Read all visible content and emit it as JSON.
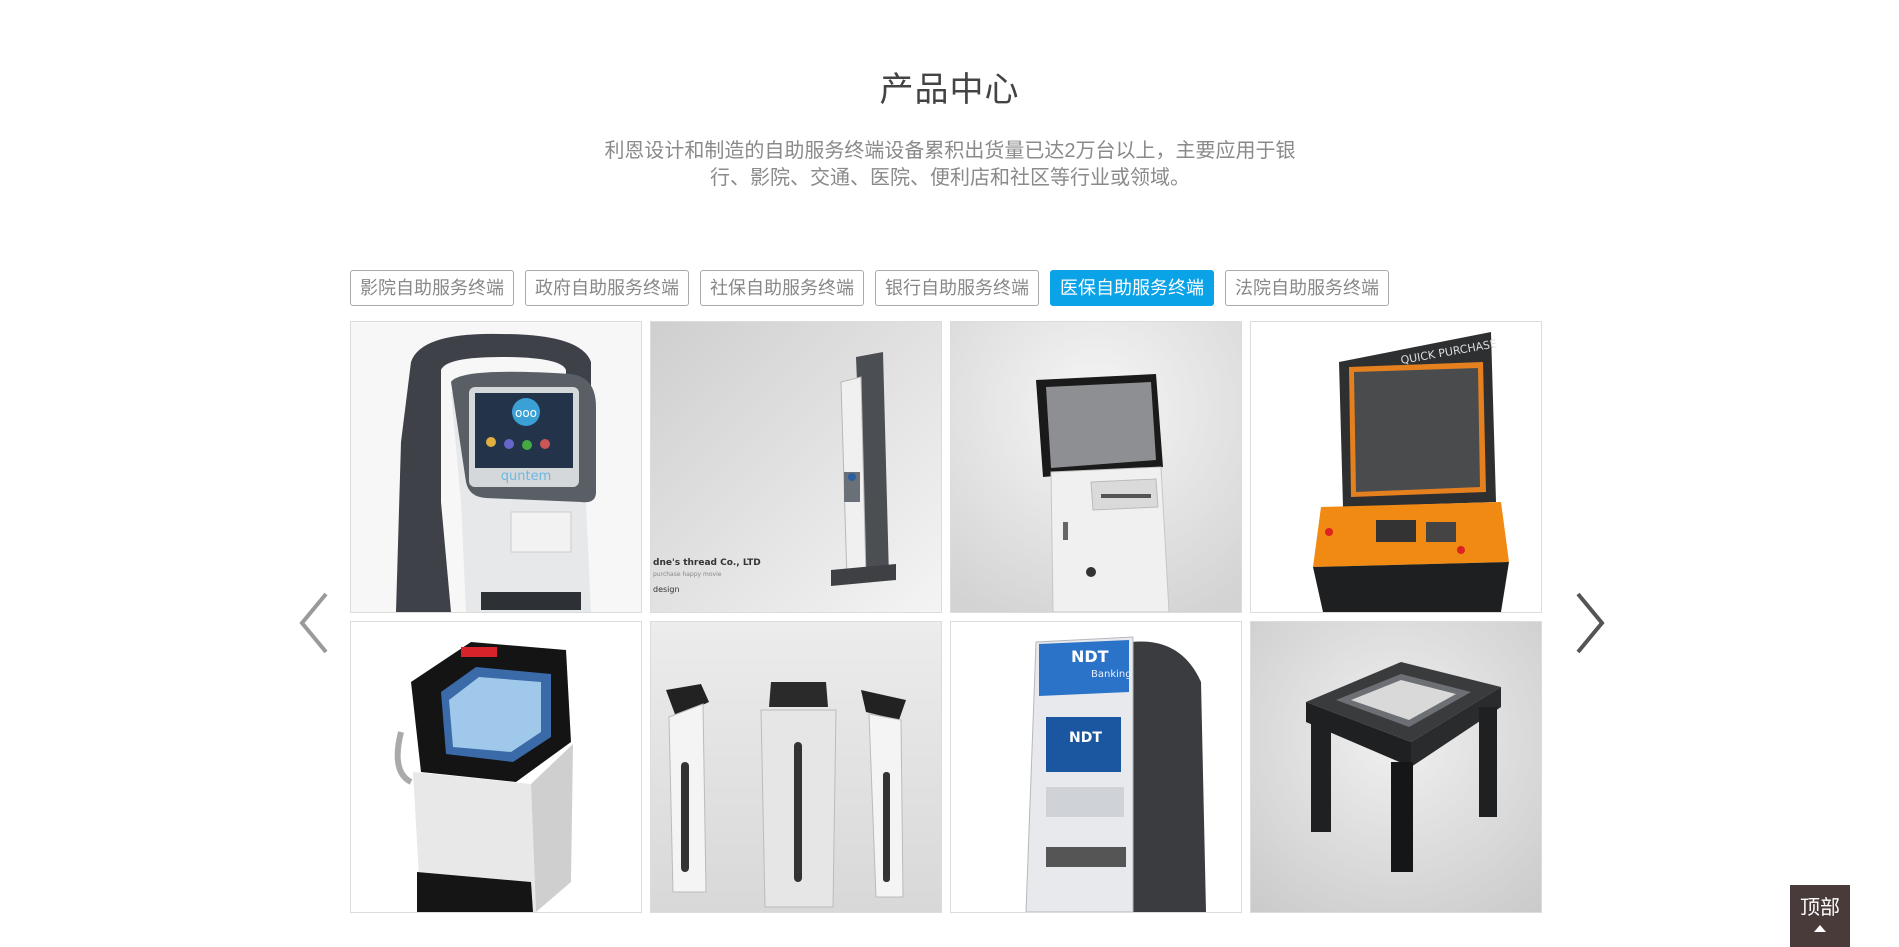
{
  "section": {
    "title": "产品中心",
    "description_line1": "利恩设计和制造的自助服务终端设备累积出货量已达2万台以上，主要应用于银",
    "description_line2": "行、影院、交通、医院、便利店和社区等行业或领域。"
  },
  "tabs": [
    {
      "label": "影院自助服务终端",
      "active": false
    },
    {
      "label": "政府自助服务终端",
      "active": false
    },
    {
      "label": "社保自助服务终端",
      "active": false
    },
    {
      "label": "银行自助服务终端",
      "active": false
    },
    {
      "label": "医保自助服务终端",
      "active": true
    },
    {
      "label": "法院自助服务终端",
      "active": false
    }
  ],
  "products": [
    {
      "image": "kiosk-handle-terminal-image",
      "screen_text": "quntem"
    },
    {
      "image": "slim-standing-kiosk-image",
      "caption_line1": "dne's thread Co., LTD",
      "caption_line2": "purchase happy movie",
      "caption_line3": "design"
    },
    {
      "image": "monitor-kiosk-printer-image"
    },
    {
      "image": "orange-quick-purchase-kiosk-image",
      "header_text": "QUICK PURCHASE"
    },
    {
      "image": "tablet-kiosk-red-light-image"
    },
    {
      "image": "three-kiosks-group-image"
    },
    {
      "image": "ndt-banking-atm-image",
      "brand_text": "NDT",
      "brand_sub": "Banking"
    },
    {
      "image": "table-touchscreen-kiosk-image"
    }
  ],
  "nav": {
    "prev_icon": "chevron-left-icon",
    "next_icon": "chevron-right-icon"
  },
  "back_to_top": {
    "label": "顶部",
    "icon": "caret-up-icon"
  },
  "colors": {
    "accent": "#0aa3e8",
    "top_button": "#4a3b3b"
  }
}
